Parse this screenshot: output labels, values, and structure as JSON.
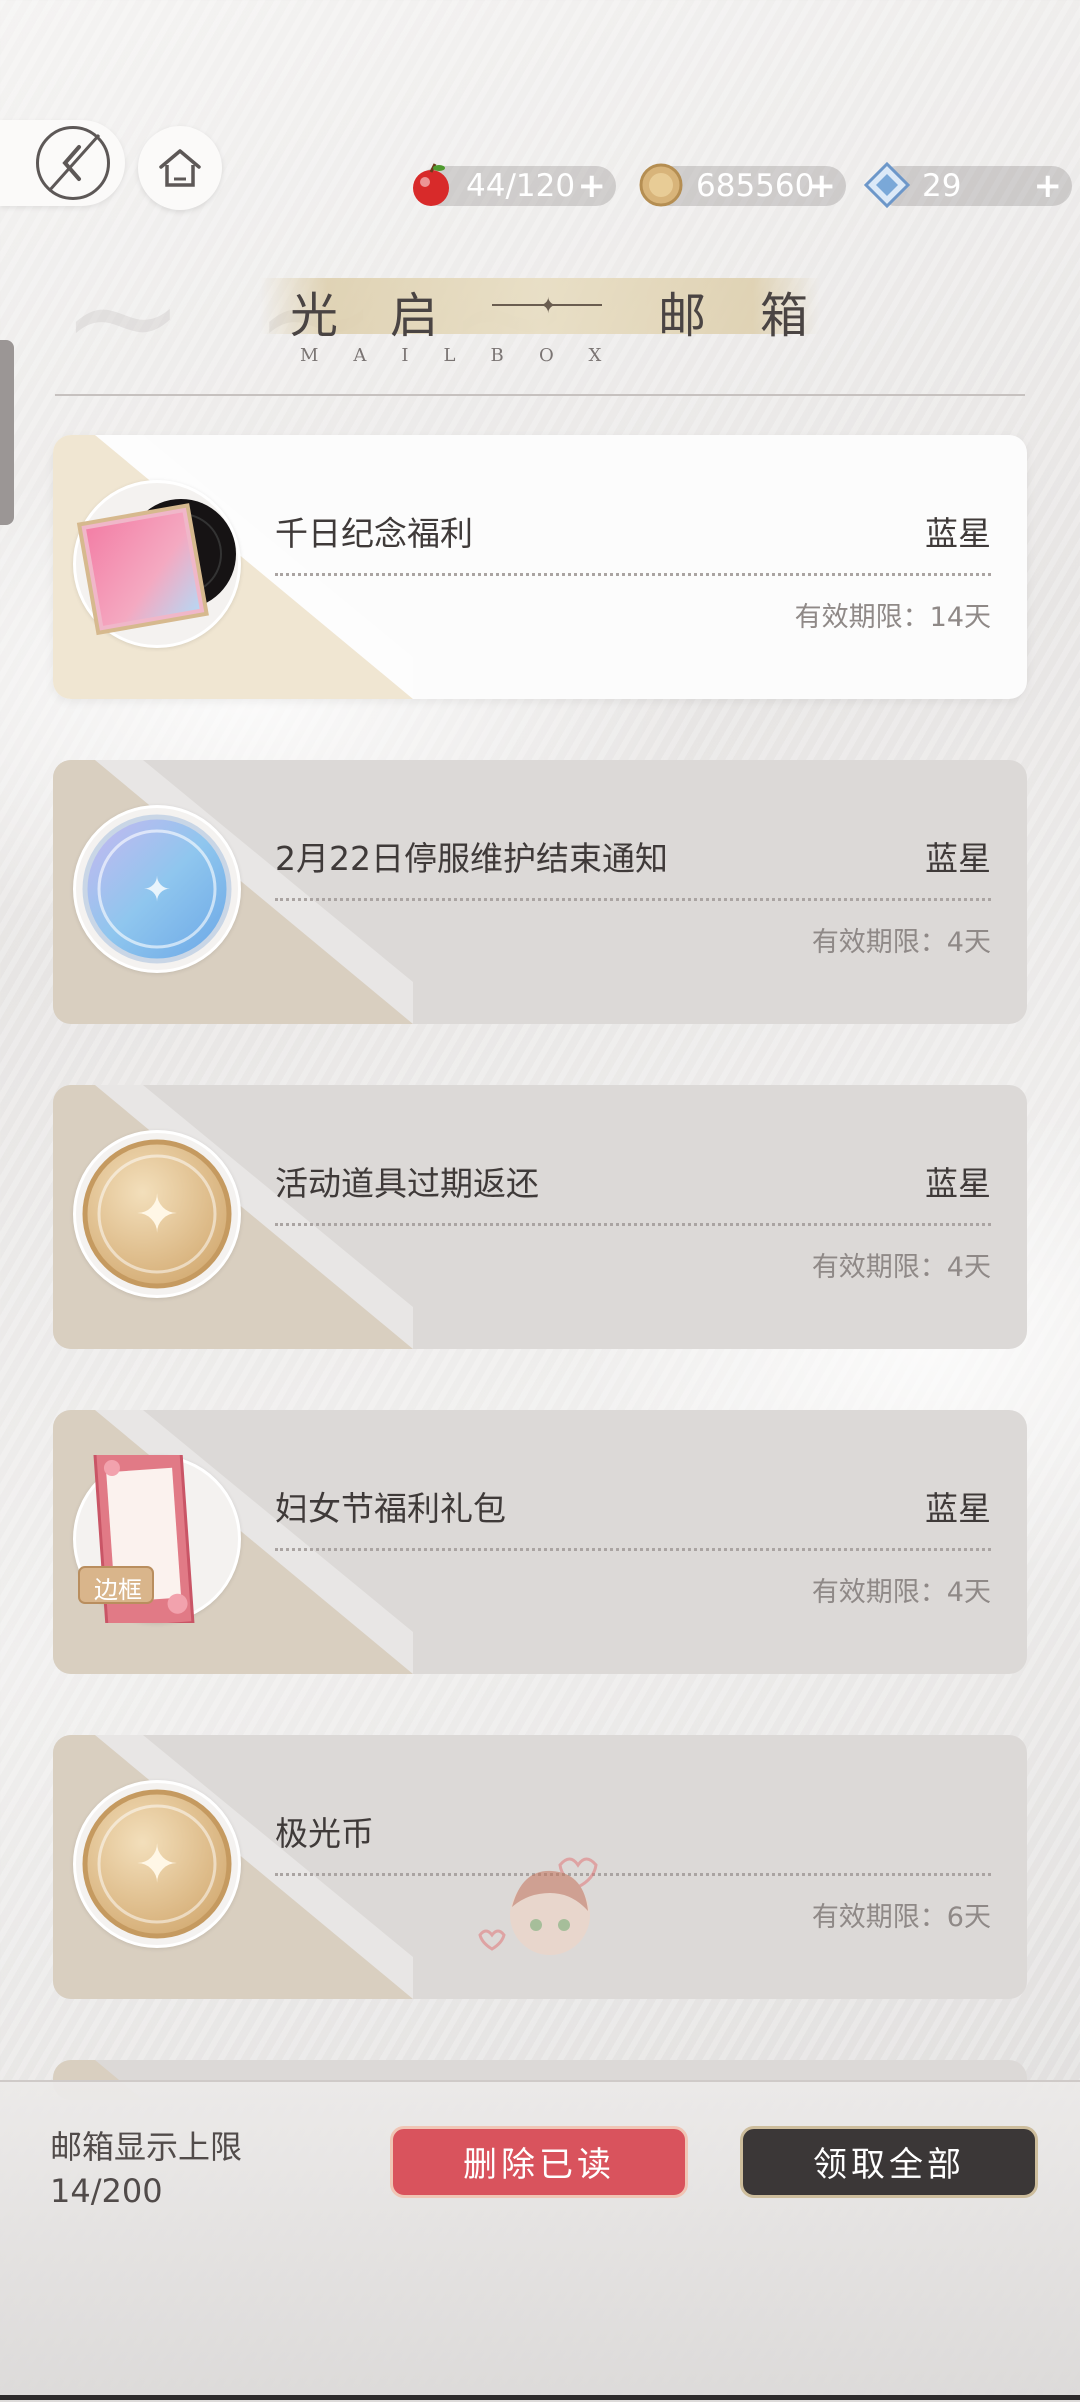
{
  "resources": {
    "stamina": {
      "value": "44/120",
      "plus": "+",
      "icon": "apple-icon",
      "color": "#d82a2a"
    },
    "gold": {
      "value": "685560",
      "plus": "+",
      "icon": "gold-coin-icon",
      "color": "#d8b47a"
    },
    "gems": {
      "value": "29",
      "plus": "+",
      "icon": "diamond-icon",
      "color": "#7aa8d8"
    }
  },
  "header": {
    "title_left": [
      "光",
      "启"
    ],
    "title_right": [
      "邮",
      "箱"
    ],
    "subtitle": "MAILBOX"
  },
  "mails": [
    {
      "title": "千日纪念福利",
      "sender": "蓝星",
      "expire": "有效期限：14天",
      "icon": "vinyl-record-icon",
      "unread": true
    },
    {
      "title": "2月22日停服维护结束通知",
      "sender": "蓝星",
      "expire": "有效期限：4天",
      "icon": "blue-coin-icon",
      "unread": false
    },
    {
      "title": "活动道具过期返还",
      "sender": "蓝星",
      "expire": "有效期限：4天",
      "icon": "gold-coin-icon",
      "unread": false
    },
    {
      "title": "妇女节福利礼包",
      "sender": "蓝星",
      "expire": "有效期限：4天",
      "icon": "frame-icon",
      "icon_label": "边框",
      "unread": false
    },
    {
      "title": "极光币",
      "sender": "",
      "expire": "有效期限：6天",
      "icon": "gold-coin-icon",
      "unread": false
    }
  ],
  "footer": {
    "capacity_label": "邮箱显示上限",
    "capacity_value": "14/200",
    "delete_read": "删除已读",
    "claim_all": "领取全部"
  },
  "colors": {
    "accent_red": "#d9535d",
    "dark_button": "#3b3737"
  }
}
